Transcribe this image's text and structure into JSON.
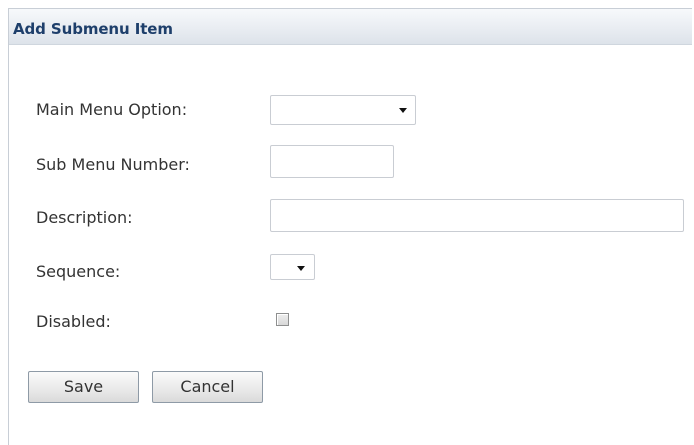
{
  "panel": {
    "title": "Add Submenu Item"
  },
  "form": {
    "main_menu_option_label": "Main Menu Option:",
    "main_menu_option_value": "",
    "sub_menu_number_label": "Sub Menu Number:",
    "sub_menu_number_value": "",
    "description_label": "Description:",
    "description_value": "",
    "sequence_label": "Sequence:",
    "sequence_value": "",
    "disabled_label": "Disabled:",
    "disabled_checked": false
  },
  "buttons": {
    "save_label": "Save",
    "cancel_label": "Cancel"
  },
  "icons": {
    "dropdown": "chevron-down-icon",
    "checkbox": "checkbox-unchecked-icon"
  },
  "colors": {
    "title_text": "#1e3f6b",
    "header_bg": "#e9edf2",
    "border": "#c9cdd3"
  }
}
